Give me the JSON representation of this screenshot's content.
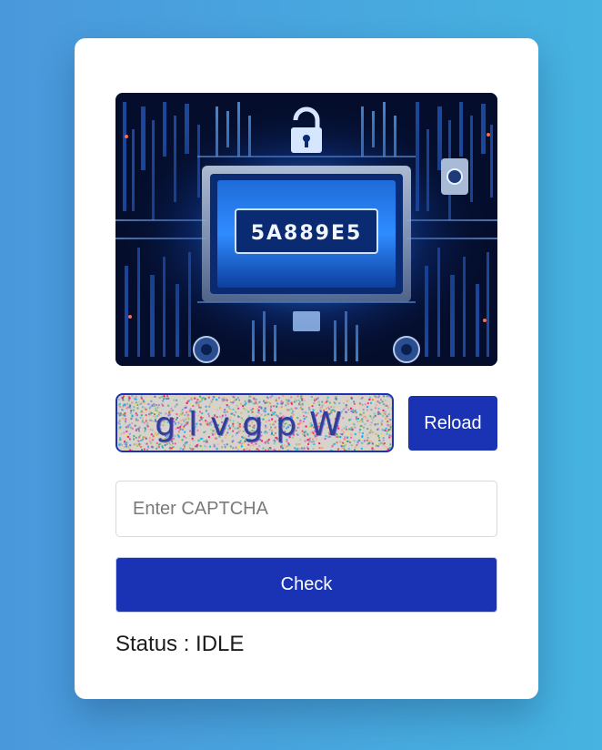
{
  "hero": {
    "code_text": "5A889E5",
    "accent": "#3aa0ff"
  },
  "captcha": {
    "text": "glvgpW"
  },
  "buttons": {
    "reload_label": "Reload",
    "check_label": "Check"
  },
  "input": {
    "placeholder": "Enter CAPTCHA",
    "value": ""
  },
  "status": {
    "label": "Status : ",
    "value": "IDLE"
  },
  "colors": {
    "primary": "#1a33b5",
    "background_start": "#4a98dc",
    "background_end": "#46b3e0"
  }
}
